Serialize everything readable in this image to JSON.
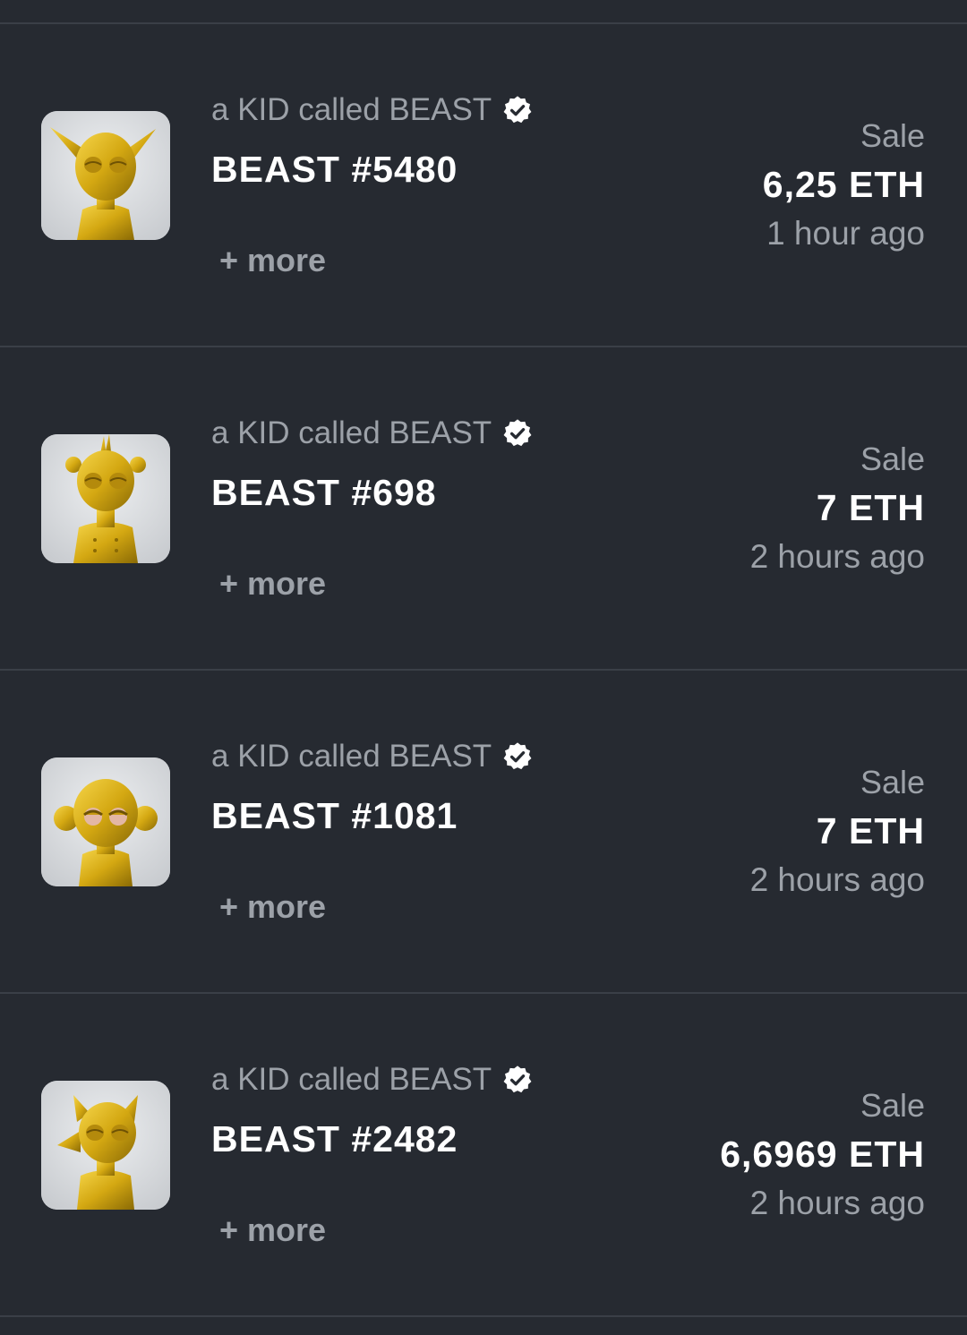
{
  "colors": {
    "background": "#262a31",
    "divider": "#3a3f47",
    "muted_text": "#9ca1a8",
    "primary_text": "#ffffff",
    "gold": "#d4a812"
  },
  "items": [
    {
      "collection": "a KID called BEAST",
      "verified_icon": "verified-badge-icon",
      "name": "BEAST #5480",
      "more": "+ more",
      "event": "Sale",
      "price": "6,25 ETH",
      "time": "1 hour ago",
      "thumbnail": "gold-beast-figure-horned"
    },
    {
      "collection": "a KID called BEAST",
      "verified_icon": "verified-badge-icon",
      "name": "BEAST #698",
      "more": "+ more",
      "event": "Sale",
      "price": "7 ETH",
      "time": "2 hours ago",
      "thumbnail": "gold-beast-figure-mohawk"
    },
    {
      "collection": "a KID called BEAST",
      "verified_icon": "verified-badge-icon",
      "name": "BEAST #1081",
      "more": "+ more",
      "event": "Sale",
      "price": "7 ETH",
      "time": "2 hours ago",
      "thumbnail": "gold-beast-figure-monkey"
    },
    {
      "collection": "a KID called BEAST",
      "verified_icon": "verified-badge-icon",
      "name": "BEAST #2482",
      "more": "+ more",
      "event": "Sale",
      "price": "6,6969 ETH",
      "time": "2 hours ago",
      "thumbnail": "gold-beast-figure-fox"
    }
  ]
}
